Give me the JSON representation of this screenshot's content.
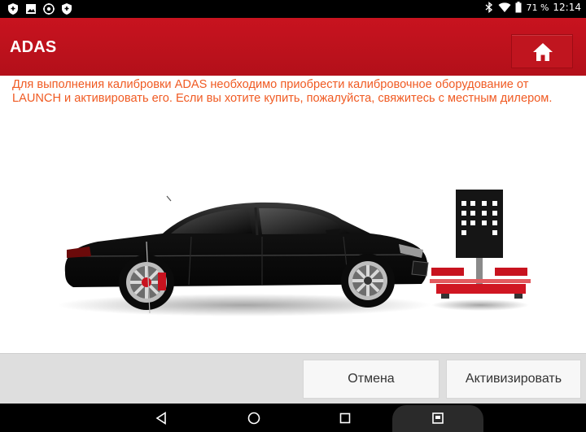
{
  "status_bar": {
    "battery": "71 %",
    "time": "12:14",
    "left_icons": [
      "shield-icon",
      "image-icon",
      "settings-icon",
      "shield-icon"
    ],
    "right_icons": [
      "bluetooth-icon",
      "wifi-icon",
      "battery-icon"
    ]
  },
  "header": {
    "title": "ADAS",
    "home_icon": "home-icon"
  },
  "message": {
    "text": "Для выполнения калибровки ADAS необходимо приобрести калибровочное оборудование от LAUNCH и активировать его. Если вы хотите купить, пожалуйста, свяжитесь с местным дилером."
  },
  "buttons": {
    "cancel": "Отмена",
    "activate": "Активизировать"
  },
  "nav": {
    "icons": [
      "back-icon",
      "home-circle-icon",
      "recents-icon",
      "screenshot-icon"
    ]
  },
  "colors": {
    "header": "#c8131f",
    "message": "#f05a22",
    "button_bar": "#dedede"
  }
}
